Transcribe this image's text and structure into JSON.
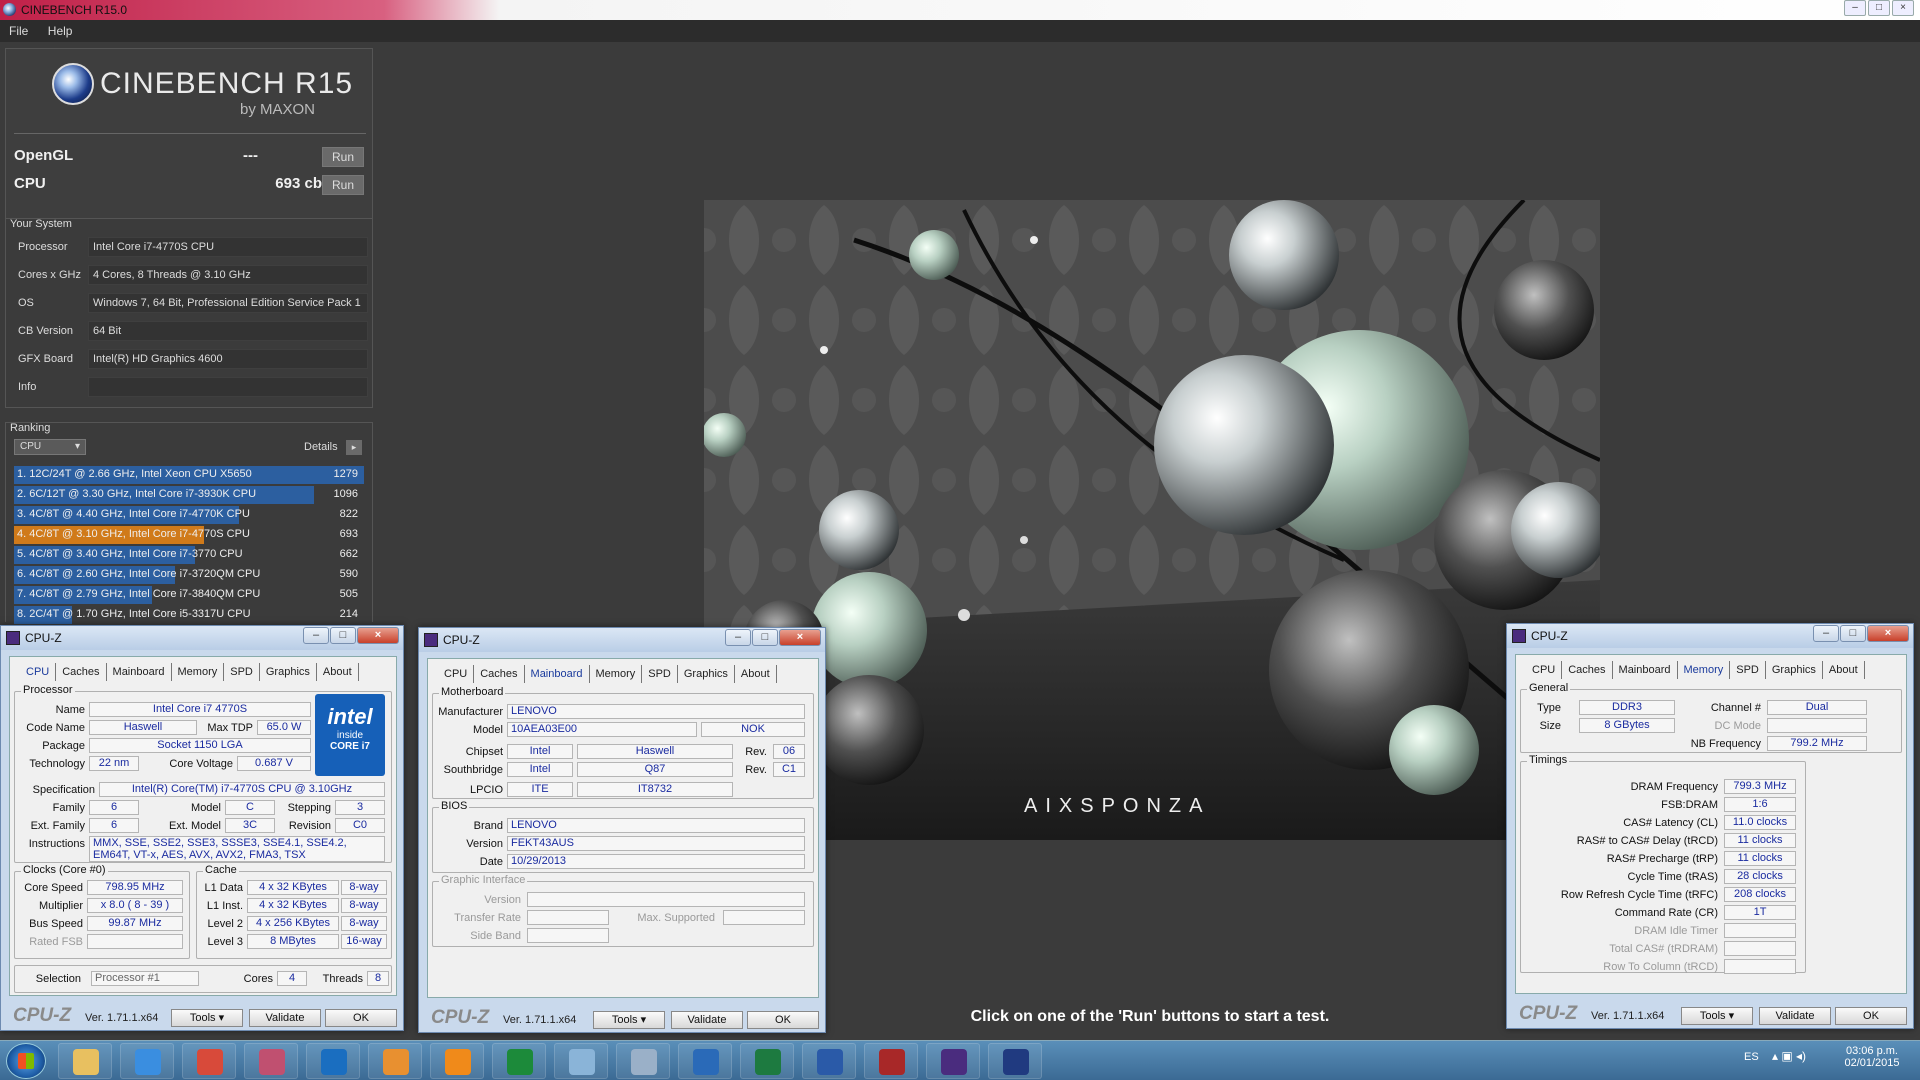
{
  "app": {
    "title": "CINEBENCH R15.0",
    "menu": [
      "File",
      "Help"
    ]
  },
  "logo": {
    "name": "CINEBENCH R15",
    "by": "by MAXON"
  },
  "tests": {
    "opengl_label": "OpenGL",
    "opengl_value": "---",
    "cpu_label": "CPU",
    "cpu_value": "693 cb",
    "run": "Run"
  },
  "system": {
    "title": "Your System",
    "rows": [
      {
        "label": "Processor",
        "value": "Intel Core i7-4770S CPU"
      },
      {
        "label": "Cores x GHz",
        "value": "4 Cores, 8 Threads @ 3.10 GHz"
      },
      {
        "label": "OS",
        "value": "Windows 7, 64 Bit, Professional Edition Service Pack 1"
      },
      {
        "label": "CB Version",
        "value": "64 Bit"
      },
      {
        "label": "GFX Board",
        "value": "Intel(R) HD Graphics 4600"
      },
      {
        "label": "Info",
        "value": ""
      }
    ]
  },
  "ranking": {
    "title": "Ranking",
    "dropdown": "CPU",
    "details": "Details",
    "items": [
      {
        "text": "1. 12C/24T @ 2.66 GHz, Intel Xeon CPU X5650",
        "score": "1279",
        "fill": 1.0,
        "color": "#2c5fa0"
      },
      {
        "text": "2. 6C/12T @ 3.30 GHz,  Intel Core i7-3930K CPU",
        "score": "1096",
        "fill": 0.857,
        "color": "#2c5fa0"
      },
      {
        "text": "3. 4C/8T @ 4.40 GHz, Intel Core i7-4770K CPU",
        "score": "822",
        "fill": 0.643,
        "color": "#2c5fa0"
      },
      {
        "text": "4. 4C/8T @ 3.10 GHz, Intel Core i7-4770S CPU",
        "score": "693",
        "fill": 0.542,
        "color": "#d07a1a"
      },
      {
        "text": "5. 4C/8T @ 3.40 GHz,  Intel Core i7-3770 CPU",
        "score": "662",
        "fill": 0.518,
        "color": "#2c5fa0"
      },
      {
        "text": "6. 4C/8T @ 2.60 GHz, Intel Core i7-3720QM CPU",
        "score": "590",
        "fill": 0.461,
        "color": "#2c5fa0"
      },
      {
        "text": "7. 4C/8T @ 2.79 GHz,  Intel Core i7-3840QM CPU",
        "score": "505",
        "fill": 0.395,
        "color": "#2c5fa0"
      },
      {
        "text": "8. 2C/4T @ 1.70 GHz,  Intel Core i5-3317U CPU",
        "score": "214",
        "fill": 0.167,
        "color": "#2c5fa0"
      }
    ]
  },
  "render": {
    "watermark": "AIXSPONZA"
  },
  "hint": "Click on one of the 'Run' buttons to start a test.",
  "cpuz1": {
    "title": "CPU-Z",
    "tabs": [
      "CPU",
      "Caches",
      "Mainboard",
      "Memory",
      "SPD",
      "Graphics",
      "About"
    ],
    "processor_title": "Processor",
    "name_l": "Name",
    "name": "Intel Core i7 4770S",
    "code_l": "Code Name",
    "code": "Haswell",
    "tdp_l": "Max TDP",
    "tdp": "65.0 W",
    "pkg_l": "Package",
    "pkg": "Socket 1150 LGA",
    "tech_l": "Technology",
    "tech": "22 nm",
    "volt_l": "Core Voltage",
    "volt": "0.687 V",
    "spec_l": "Specification",
    "spec": "Intel(R) Core(TM) i7-4770S CPU @ 3.10GHz",
    "fam_l": "Family",
    "fam": "6",
    "model_l": "Model",
    "model": "C",
    "step_l": "Stepping",
    "step": "3",
    "efam_l": "Ext. Family",
    "efam": "6",
    "emodel_l": "Ext. Model",
    "emodel": "3C",
    "rev_l": "Revision",
    "rev": "C0",
    "instr_l": "Instructions",
    "instr": "MMX, SSE, SSE2, SSE3, SSSE3, SSE4.1, SSE4.2, EM64T, VT-x, AES, AVX, AVX2, FMA3, TSX",
    "clocks_title": "Clocks (Core #0)",
    "cache_title": "Cache",
    "cs_l": "Core Speed",
    "cs": "798.95 MHz",
    "mul_l": "Multiplier",
    "mul": "x 8.0 ( 8 - 39 )",
    "bus_l": "Bus Speed",
    "bus": "99.87 MHz",
    "fsb_l": "Rated FSB",
    "fsb": "",
    "l1d_l": "L1 Data",
    "l1d": "4 x 32 KBytes",
    "l1d_w": "8-way",
    "l1i_l": "L1 Inst.",
    "l1i": "4 x 32 KBytes",
    "l1i_w": "8-way",
    "l2_l": "Level 2",
    "l2": "4 x 256 KBytes",
    "l2_w": "8-way",
    "l3_l": "Level 3",
    "l3": "8 MBytes",
    "l3_w": "16-way",
    "sel_l": "Selection",
    "sel": "Processor #1",
    "cores_l": "Cores",
    "cores": "4",
    "thr_l": "Threads",
    "thr": "8",
    "intel1": "intel",
    "intel2": "inside",
    "intel3": "CORE i7",
    "ver": "Ver. 1.71.1.x64",
    "tools": "Tools",
    "validate": "Validate",
    "ok": "OK",
    "brand": "CPU-Z"
  },
  "cpuz2": {
    "title": "CPU-Z",
    "tabs": [
      "CPU",
      "Caches",
      "Mainboard",
      "Memory",
      "SPD",
      "Graphics",
      "About"
    ],
    "mb_title": "Motherboard",
    "man_l": "Manufacturer",
    "man": "LENOVO",
    "mod_l": "Model",
    "mod": "10AEA03E00",
    "mod2": "NOK",
    "chip_l": "Chipset",
    "chip1": "Intel",
    "chip2": "Haswell",
    "crev_l": "Rev.",
    "crev": "06",
    "sb_l": "Southbridge",
    "sb1": "Intel",
    "sb2": "Q87",
    "srev_l": "Rev.",
    "srev": "C1",
    "lpc_l": "LPCIO",
    "lpc1": "ITE",
    "lpc2": "IT8732",
    "bios_title": "BIOS",
    "brand_l": "Brand",
    "brandv": "LENOVO",
    "ver_l": "Version",
    "verv": "FEKT43AUS",
    "date_l": "Date",
    "datev": "10/29/2013",
    "gi_title": "Graphic Interface",
    "gv_l": "Version",
    "tr_l": "Transfer Rate",
    "ms_l": "Max. Supported",
    "sbnd_l": "Side Band",
    "ver": "Ver. 1.71.1.x64",
    "tools": "Tools",
    "validate": "Validate",
    "ok": "OK",
    "brand": "CPU-Z"
  },
  "cpuz3": {
    "title": "CPU-Z",
    "tabs": [
      "CPU",
      "Caches",
      "Mainboard",
      "Memory",
      "SPD",
      "Graphics",
      "About"
    ],
    "gen_title": "General",
    "type_l": "Type",
    "type": "DDR3",
    "ch_l": "Channel #",
    "ch": "Dual",
    "size_l": "Size",
    "size": "8 GBytes",
    "dc_l": "DC Mode",
    "nb_l": "NB Frequency",
    "nb": "799.2 MHz",
    "tim_title": "Timings",
    "timings": [
      {
        "l": "DRAM Frequency",
        "v": "799.3 MHz",
        "g": false
      },
      {
        "l": "FSB:DRAM",
        "v": "1:6",
        "g": false
      },
      {
        "l": "CAS# Latency (CL)",
        "v": "11.0 clocks",
        "g": false
      },
      {
        "l": "RAS# to CAS# Delay (tRCD)",
        "v": "11 clocks",
        "g": false
      },
      {
        "l": "RAS# Precharge (tRP)",
        "v": "11 clocks",
        "g": false
      },
      {
        "l": "Cycle Time (tRAS)",
        "v": "28 clocks",
        "g": false
      },
      {
        "l": "Row Refresh Cycle Time (tRFC)",
        "v": "208 clocks",
        "g": false
      },
      {
        "l": "Command Rate (CR)",
        "v": "1T",
        "g": false
      },
      {
        "l": "DRAM Idle Timer",
        "v": "",
        "g": true
      },
      {
        "l": "Total CAS# (tRDRAM)",
        "v": "",
        "g": true
      },
      {
        "l": "Row To Column (tRCD)",
        "v": "",
        "g": true
      }
    ],
    "ver": "Ver. 1.71.1.x64",
    "tools": "Tools",
    "validate": "Validate",
    "ok": "OK",
    "brand": "CPU-Z"
  },
  "taskbar": {
    "lang": "ES",
    "time": "03:06 p.m.",
    "date": "02/01/2015",
    "apps": [
      {
        "name": "explorer-icon",
        "color": "#e8c060"
      },
      {
        "name": "internet-explorer-icon",
        "color": "#3a8ee0"
      },
      {
        "name": "chrome-icon",
        "color": "#d84a3a"
      },
      {
        "name": "snipping-tool-icon",
        "color": "#c05070"
      },
      {
        "name": "outlook-icon",
        "color": "#1a6ec0"
      },
      {
        "name": "folder-icon",
        "color": "#e89030"
      },
      {
        "name": "app-orange-icon",
        "color": "#f08a1a"
      },
      {
        "name": "excel-viewer-icon",
        "color": "#1c8a3a"
      },
      {
        "name": "notepad-icon",
        "color": "#8ab4d8"
      },
      {
        "name": "calculator-icon",
        "color": "#9ab0c8"
      },
      {
        "name": "remote-desktop-icon",
        "color": "#2a6ab8"
      },
      {
        "name": "excel-icon",
        "color": "#1d7a40"
      },
      {
        "name": "word-icon",
        "color": "#2a5aa8"
      },
      {
        "name": "access-icon",
        "color": "#a82828"
      },
      {
        "name": "cpuz-icon",
        "color": "#4a2c7e"
      },
      {
        "name": "cinebench-icon",
        "color": "#203a80"
      }
    ]
  }
}
